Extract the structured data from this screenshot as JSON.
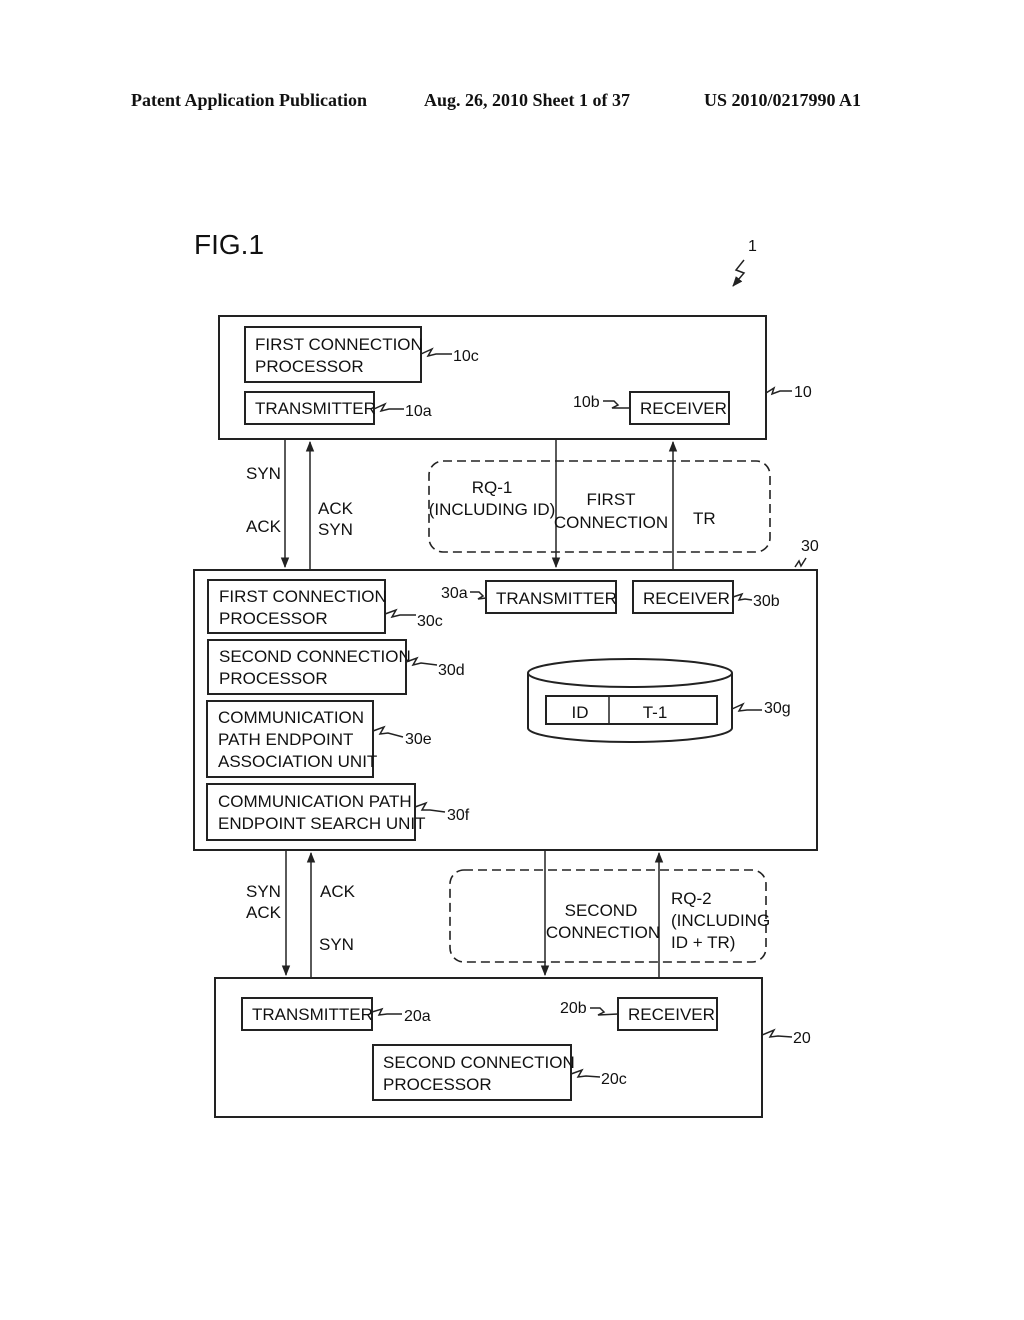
{
  "header": {
    "publication": "Patent Application Publication",
    "date_sheet": "Aug. 26, 2010  Sheet 1 of 37",
    "number": "US 2010/0217990 A1"
  },
  "figure": {
    "title": "FIG.1",
    "system_ref": "1",
    "device_10": {
      "ref": "10",
      "first_connection_processor": {
        "line1": "FIRST CONNECTION",
        "line2": "PROCESSOR",
        "ref": "10c"
      },
      "transmitter": {
        "label": "TRANSMITTER",
        "ref": "10a"
      },
      "receiver": {
        "label": "RECEIVER",
        "ref": "10b"
      }
    },
    "upper_link": {
      "left_down_labels": [
        "SYN",
        "ACK"
      ],
      "left_up_labels": [
        "ACK",
        "SYN"
      ],
      "rq1": {
        "line1": "RQ-1",
        "line2": "(INCLUDING ID)"
      },
      "first_connection": {
        "line1": "FIRST",
        "line2": "CONNECTION"
      },
      "tr": "TR"
    },
    "device_30": {
      "ref": "30",
      "first_connection_processor": {
        "line1": "FIRST CONNECTION",
        "line2": "PROCESSOR",
        "ref": "30c"
      },
      "second_connection_processor": {
        "line1": "SECOND CONNECTION",
        "line2": "PROCESSOR",
        "ref": "30d"
      },
      "association_unit": {
        "line1": "COMMUNICATION",
        "line2": "PATH ENDPOINT",
        "line3": "ASSOCIATION UNIT",
        "ref": "30e"
      },
      "search_unit": {
        "line1": "COMMUNICATION PATH",
        "line2": "ENDPOINT SEARCH UNIT",
        "ref": "30f"
      },
      "transmitter": {
        "label": "TRANSMITTER",
        "ref": "30a"
      },
      "receiver": {
        "label": "RECEIVER",
        "ref": "30b"
      },
      "storage": {
        "ref": "30g",
        "record": [
          "ID",
          "T-1"
        ]
      }
    },
    "lower_link": {
      "left_down_labels": [
        "SYN",
        "ACK"
      ],
      "left_up_labels": [
        "ACK",
        "SYN"
      ],
      "second_connection": {
        "line1": "SECOND",
        "line2": "CONNECTION"
      },
      "rq2": {
        "line1": "RQ-2",
        "line2": "(INCLUDING",
        "line3": "ID + TR)"
      }
    },
    "device_20": {
      "ref": "20",
      "transmitter": {
        "label": "TRANSMITTER",
        "ref": "20a"
      },
      "receiver": {
        "label": "RECEIVER",
        "ref": "20b"
      },
      "second_connection_processor": {
        "line1": "SECOND CONNECTION",
        "line2": "PROCESSOR",
        "ref": "20c"
      }
    }
  }
}
